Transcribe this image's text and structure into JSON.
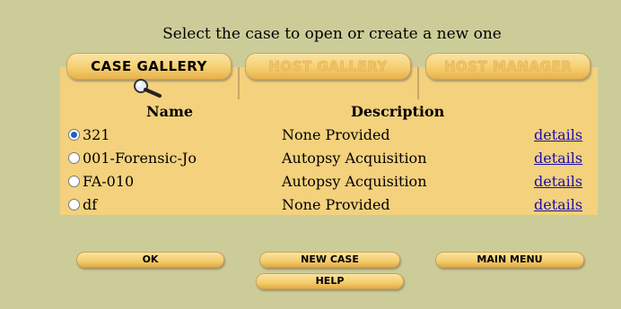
{
  "header": {
    "prompt": "Select the case to open or create a new one"
  },
  "tabs": [
    {
      "label": "CASE GALLERY",
      "active": true
    },
    {
      "label": "HOST GALLERY",
      "active": false
    },
    {
      "label": "HOST MANAGER",
      "active": false
    }
  ],
  "table": {
    "columns": {
      "name": "Name",
      "description": "Description"
    },
    "rows": [
      {
        "name": "321",
        "description": "None Provided",
        "link": "details",
        "selected": true
      },
      {
        "name": "001-Forensic-Jo",
        "description": "Autopsy Acquisition",
        "link": "details",
        "selected": false
      },
      {
        "name": "FA-010",
        "description": "Autopsy Acquisition",
        "link": "details",
        "selected": false
      },
      {
        "name": "df",
        "description": "None Provided",
        "link": "details",
        "selected": false
      }
    ]
  },
  "buttons": {
    "ok": "OK",
    "new_case": "NEW CASE",
    "main_menu": "MAIN MENU",
    "help": "HELP"
  },
  "colors": {
    "background": "#cccc99",
    "panel": "#f4d17d",
    "accent_radio": "#1c63b7",
    "link": "#1a0dab"
  }
}
